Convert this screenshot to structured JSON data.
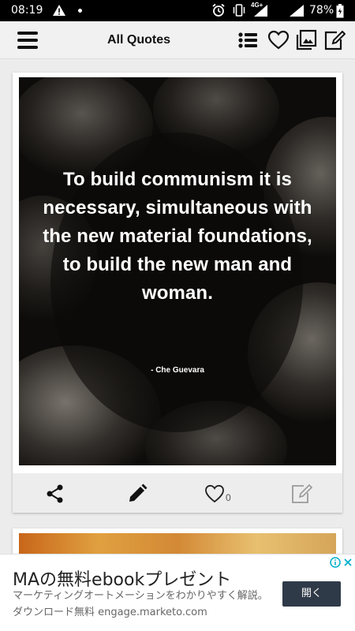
{
  "status_bar": {
    "time": "08:19",
    "network_type": "4G+",
    "battery": "78%"
  },
  "app_bar": {
    "title": "All Quotes",
    "icons": [
      "menu-icon",
      "list-icon",
      "heart-icon",
      "gallery-icon",
      "edit-icon"
    ]
  },
  "quote_card": {
    "text": "To build communism it is necessary, simultaneous with the new material foundations, to build the new man and woman.",
    "author": "- Che Guevara",
    "like_count": "0",
    "actions": [
      "share-icon",
      "pencil-icon",
      "heart-outline-icon",
      "edit-quote-icon"
    ]
  },
  "ad": {
    "title": "MAの無料ebookプレゼント",
    "description": "マーケティングオートメーションをわかりやすく解説。ダウンロード無料 engage.marketo.com",
    "button_label": "開く"
  },
  "colors": {
    "status_bar_bg": "#000000",
    "app_bar_bg": "#f1f1f1",
    "ad_button_bg": "#2f3a48",
    "adchoices_blue": "#00aecd"
  }
}
